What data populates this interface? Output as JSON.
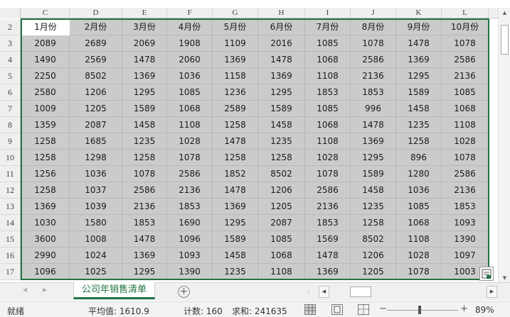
{
  "columns": [
    "C",
    "D",
    "E",
    "F",
    "G",
    "H",
    "I",
    "J",
    "K",
    "L"
  ],
  "rows": [
    "2",
    "3",
    "4",
    "5",
    "6",
    "7",
    "8",
    "9",
    "10",
    "11",
    "12",
    "13",
    "14",
    "15",
    "16",
    "17"
  ],
  "table": [
    [
      "1月份",
      "2月份",
      "3月份",
      "4月份",
      "5月份",
      "6月份",
      "7月份",
      "8月份",
      "9月份",
      "10月份"
    ],
    [
      "2089",
      "2689",
      "2069",
      "1908",
      "1109",
      "2016",
      "1085",
      "1078",
      "1478",
      "1078"
    ],
    [
      "1490",
      "2569",
      "1478",
      "2060",
      "1369",
      "1478",
      "1068",
      "2586",
      "1369",
      "2586"
    ],
    [
      "2250",
      "8502",
      "1369",
      "1036",
      "1158",
      "1369",
      "1108",
      "2136",
      "1295",
      "2136"
    ],
    [
      "2580",
      "1206",
      "1295",
      "1085",
      "1236",
      "1295",
      "1853",
      "1853",
      "1589",
      "1085"
    ],
    [
      "1009",
      "1205",
      "1589",
      "1068",
      "2589",
      "1589",
      "1085",
      "996",
      "1458",
      "1068"
    ],
    [
      "1359",
      "2087",
      "1458",
      "1108",
      "1258",
      "1458",
      "1068",
      "1478",
      "1235",
      "1108"
    ],
    [
      "1258",
      "1685",
      "1235",
      "1028",
      "1478",
      "1235",
      "1108",
      "1369",
      "1258",
      "1028"
    ],
    [
      "1258",
      "1298",
      "1258",
      "1078",
      "1258",
      "1258",
      "1028",
      "1295",
      "896",
      "1078"
    ],
    [
      "1256",
      "1036",
      "1078",
      "2586",
      "1852",
      "8502",
      "1078",
      "1589",
      "1280",
      "2586"
    ],
    [
      "1258",
      "1037",
      "2586",
      "2136",
      "1478",
      "1206",
      "2586",
      "1458",
      "1036",
      "2136"
    ],
    [
      "1369",
      "1039",
      "2136",
      "1853",
      "1369",
      "1205",
      "2136",
      "1235",
      "1085",
      "1853"
    ],
    [
      "1030",
      "1580",
      "1853",
      "1690",
      "1295",
      "2087",
      "1853",
      "1258",
      "1068",
      "1093"
    ],
    [
      "3600",
      "1008",
      "1478",
      "1096",
      "1589",
      "1085",
      "1569",
      "8502",
      "1108",
      "1390"
    ],
    [
      "2990",
      "1024",
      "1369",
      "1093",
      "1458",
      "1068",
      "1478",
      "1206",
      "1028",
      "1097"
    ],
    [
      "1096",
      "1025",
      "1295",
      "1390",
      "1235",
      "1108",
      "1369",
      "1205",
      "1078",
      "1003"
    ]
  ],
  "sheet_tab": "公司年销售清单",
  "add_sheet_symbol": "+",
  "status": {
    "ready": "就绪",
    "average": "平均值: 1610.9",
    "count": "计数: 160",
    "sum": "求和: 241635",
    "zoom": "89%",
    "zoom_minus": "−",
    "zoom_plus": "+"
  },
  "colors": {
    "accent": "#217346",
    "selection_fill": "#cbcbcb"
  }
}
